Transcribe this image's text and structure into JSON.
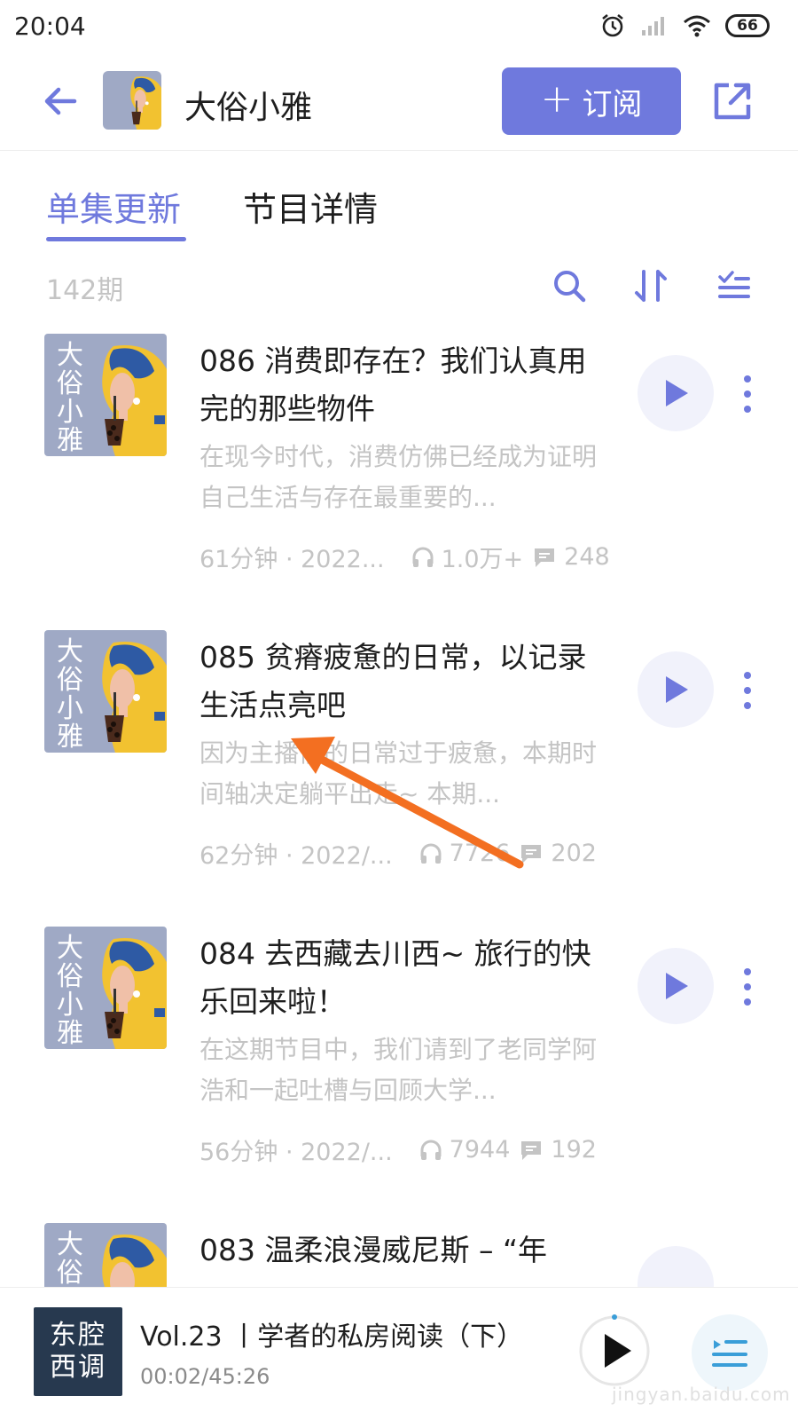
{
  "status_bar": {
    "time": "20:04",
    "battery": "66",
    "icons": [
      "alarm-icon",
      "signal-icon",
      "wifi-icon",
      "battery-icon"
    ]
  },
  "header": {
    "podcast_title": "大俗小雅",
    "subscribe_label": "订阅",
    "icons": [
      "back-arrow-icon",
      "share-icon"
    ]
  },
  "tabs": [
    {
      "label": "单集更新",
      "active": true
    },
    {
      "label": "节目详情",
      "active": false
    }
  ],
  "episode_count": "142期",
  "toolbar_icons": [
    "search-icon",
    "sort-icon",
    "filter-icon"
  ],
  "cover_text": "大俗小雅",
  "episodes": [
    {
      "title": "086 消费即存在？我们认真用完的那些物件",
      "desc": "在现今时代，消费仿佛已经成为证明自己生活与存在最重要的...",
      "duration_date": "61分钟 · 2022...",
      "plays": "1.0万+",
      "comments": "248"
    },
    {
      "title": "085 贫瘠疲惫的日常，以记录生活点亮吧",
      "desc": "因为主播们的日常过于疲惫，本期时间轴决定躺平出走~ 本期...",
      "duration_date": "62分钟 · 2022/...",
      "plays": "7726",
      "comments": "202"
    },
    {
      "title": "084 去西藏去川西~ 旅行的快乐回来啦！",
      "desc": "在这期节目中，我们请到了老同学阿浩和一起吐槽与回顾大学...",
      "duration_date": "56分钟 · 2022/...",
      "plays": "7944",
      "comments": "192"
    },
    {
      "title": "083 温柔浪漫威尼斯 – “年",
      "desc": "",
      "duration_date": "",
      "plays": "",
      "comments": ""
    }
  ],
  "mini_player": {
    "cover_text": "东腔\n西调",
    "title": "Vol.23 丨学者的私房阅读（下）",
    "time": "00:02/45:26"
  },
  "watermark": "jingyan.baidu.com",
  "colors": {
    "accent": "#6f79dd",
    "play_bg": "#f1f2fb",
    "muted_text": "#c4c4c4",
    "cover_bg": "#9fa9c5",
    "cover_yellow": "#f2c230",
    "cover_blue": "#2e5aa4",
    "annotation_arrow": "#f36f21",
    "mini_cover_bg": "#27394f"
  }
}
